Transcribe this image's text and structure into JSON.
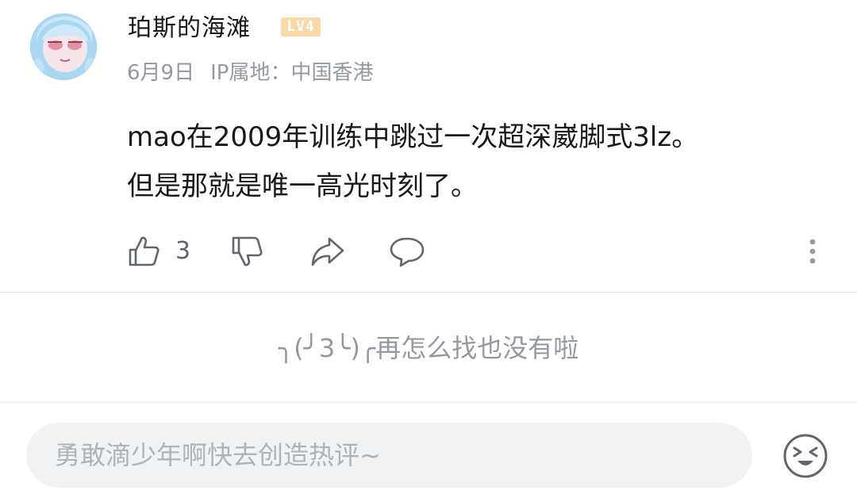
{
  "comment": {
    "username": "珀斯的海滩",
    "level_badge": "LV4",
    "date": "6月9日",
    "ip_location": "IP属地：中国香港",
    "text_lines": [
      "mao在2009年训练中跳过一次超深崴脚式3lz。",
      "但是那就是唯一高光时刻了。"
    ],
    "like_count": "3",
    "icons": {
      "like": "thumbs-up-icon",
      "dislike": "thumbs-down-icon",
      "share": "share-icon",
      "reply": "comment-icon",
      "more": "more-vertical-icon"
    }
  },
  "replies": {
    "empty_text": "╮(╯3╰)╭再怎么找也没有啦"
  },
  "reply_bar": {
    "placeholder": "勇敢滴少年啊快去创造热评~",
    "emoji_icon": "emoji-icon"
  },
  "colors": {
    "primary_text": "#18191c",
    "secondary_text": "#9499a0",
    "icon": "#61666d",
    "divider": "#e3e5e7",
    "input_bg": "#f1f2f3",
    "level_badge": "#fbd9a6"
  }
}
